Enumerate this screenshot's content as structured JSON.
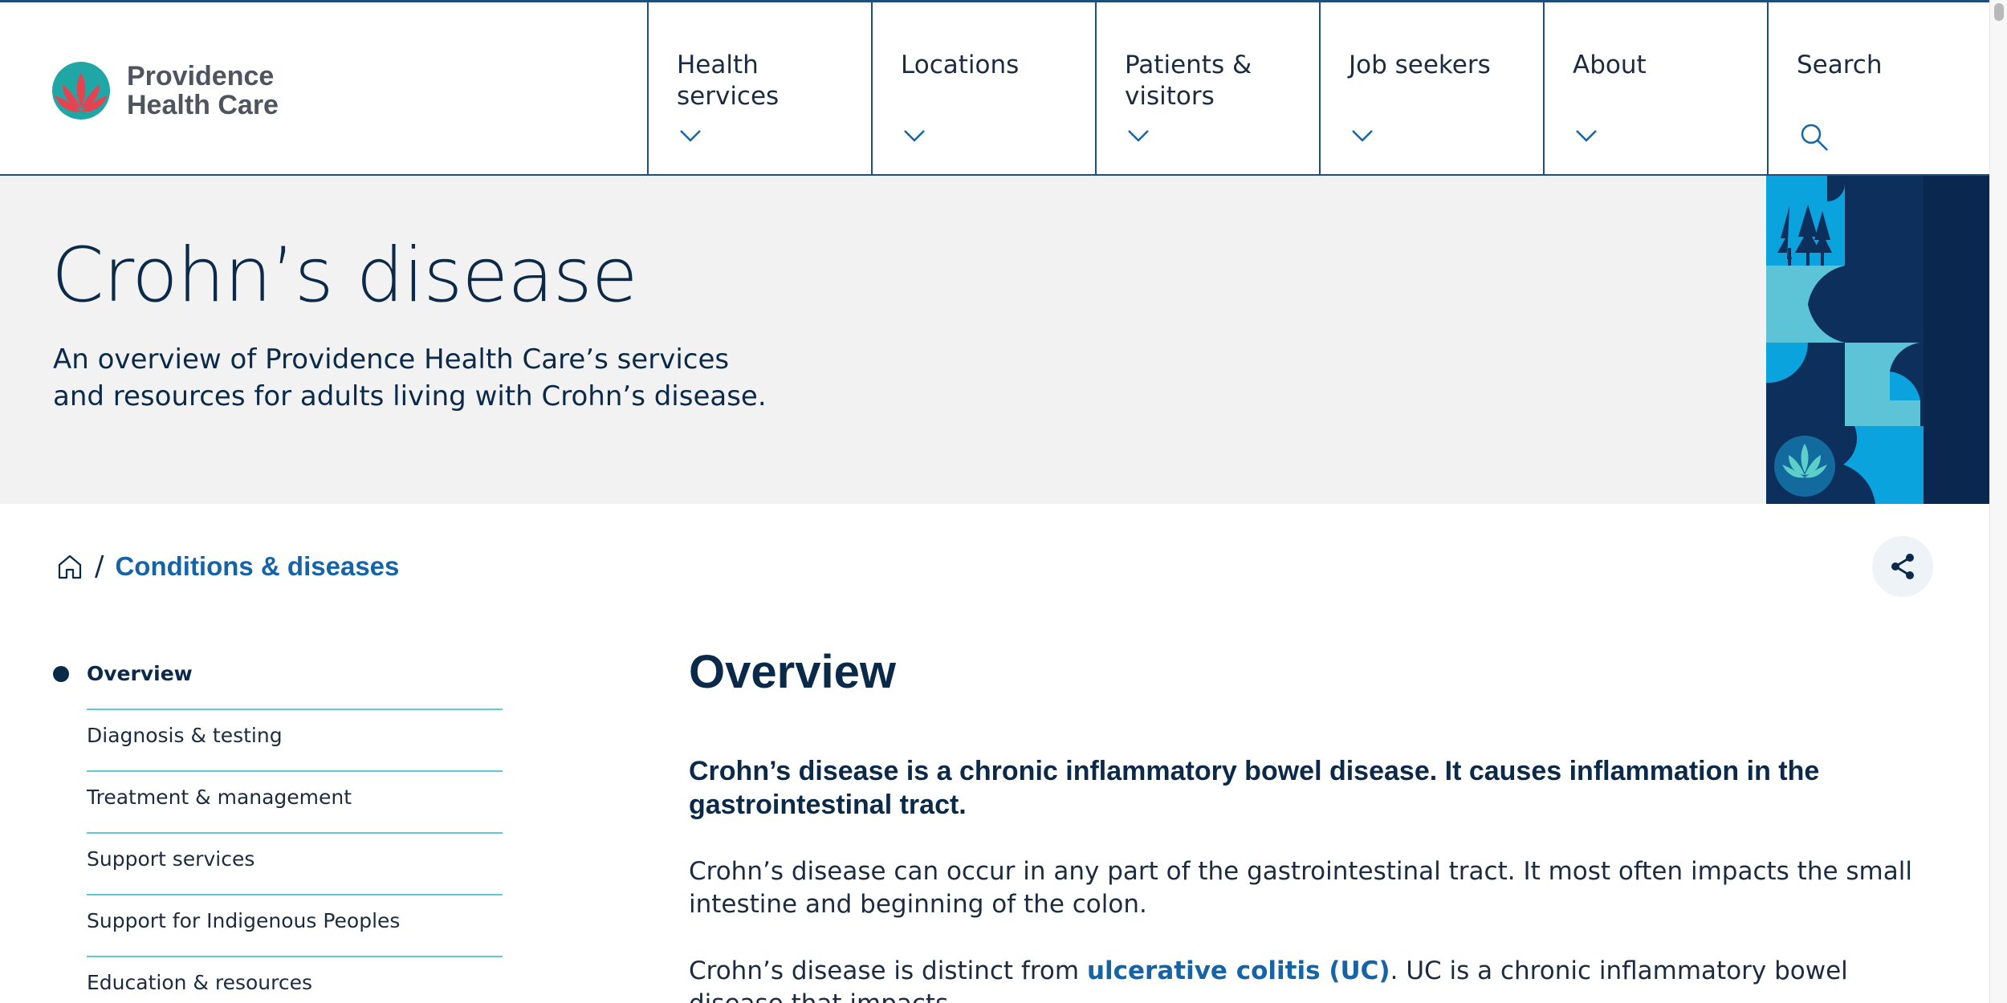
{
  "colors": {
    "navy": "#0b2a4a",
    "link_blue": "#1564a8",
    "teal": "#5fc9cf",
    "hero_bg": "#f2f2f2",
    "border": "#1d4f7c"
  },
  "brand": {
    "logo_line1": "Providence",
    "logo_line2": "Health Care",
    "logo_icon": "lotus-icon"
  },
  "nav": {
    "items": [
      {
        "label": "Health services",
        "icon": "chevron-down-icon"
      },
      {
        "label": "Locations",
        "icon": "chevron-down-icon"
      },
      {
        "label": "Patients & visitors",
        "icon": "chevron-down-icon"
      },
      {
        "label": "Job seekers",
        "icon": "chevron-down-icon"
      },
      {
        "label": "About",
        "icon": "chevron-down-icon"
      },
      {
        "label": "Search",
        "icon": "search-icon"
      }
    ]
  },
  "hero": {
    "title": "Crohn’s disease",
    "subtitle": "An overview of Providence Health Care’s services and resources for adults living with Crohn’s disease."
  },
  "breadcrumb": {
    "home_icon": "home-icon",
    "separator": "/",
    "current": "Conditions & diseases"
  },
  "share": {
    "icon": "share-icon"
  },
  "sidenav": {
    "items": [
      {
        "label": "Overview",
        "active": true
      },
      {
        "label": "Diagnosis & testing",
        "active": false
      },
      {
        "label": "Treatment & management",
        "active": false
      },
      {
        "label": "Support services",
        "active": false
      },
      {
        "label": "Support for Indigenous Peoples",
        "active": false
      },
      {
        "label": "Education & resources",
        "active": false
      }
    ]
  },
  "main": {
    "heading": "Overview",
    "lead": "Crohn’s disease is a chronic inflammatory bowel disease. It causes inflammation in the gastrointestinal tract.",
    "para1": "Crohn’s disease can occur in any part of the gastrointestinal tract. It most often impacts the small intestine and beginning of the colon.",
    "para2_before": "Crohn’s disease is distinct from ",
    "para2_link": "ulcerative colitis (UC)",
    "para2_after": ". UC is a chronic inflammatory bowel disease that impacts"
  }
}
